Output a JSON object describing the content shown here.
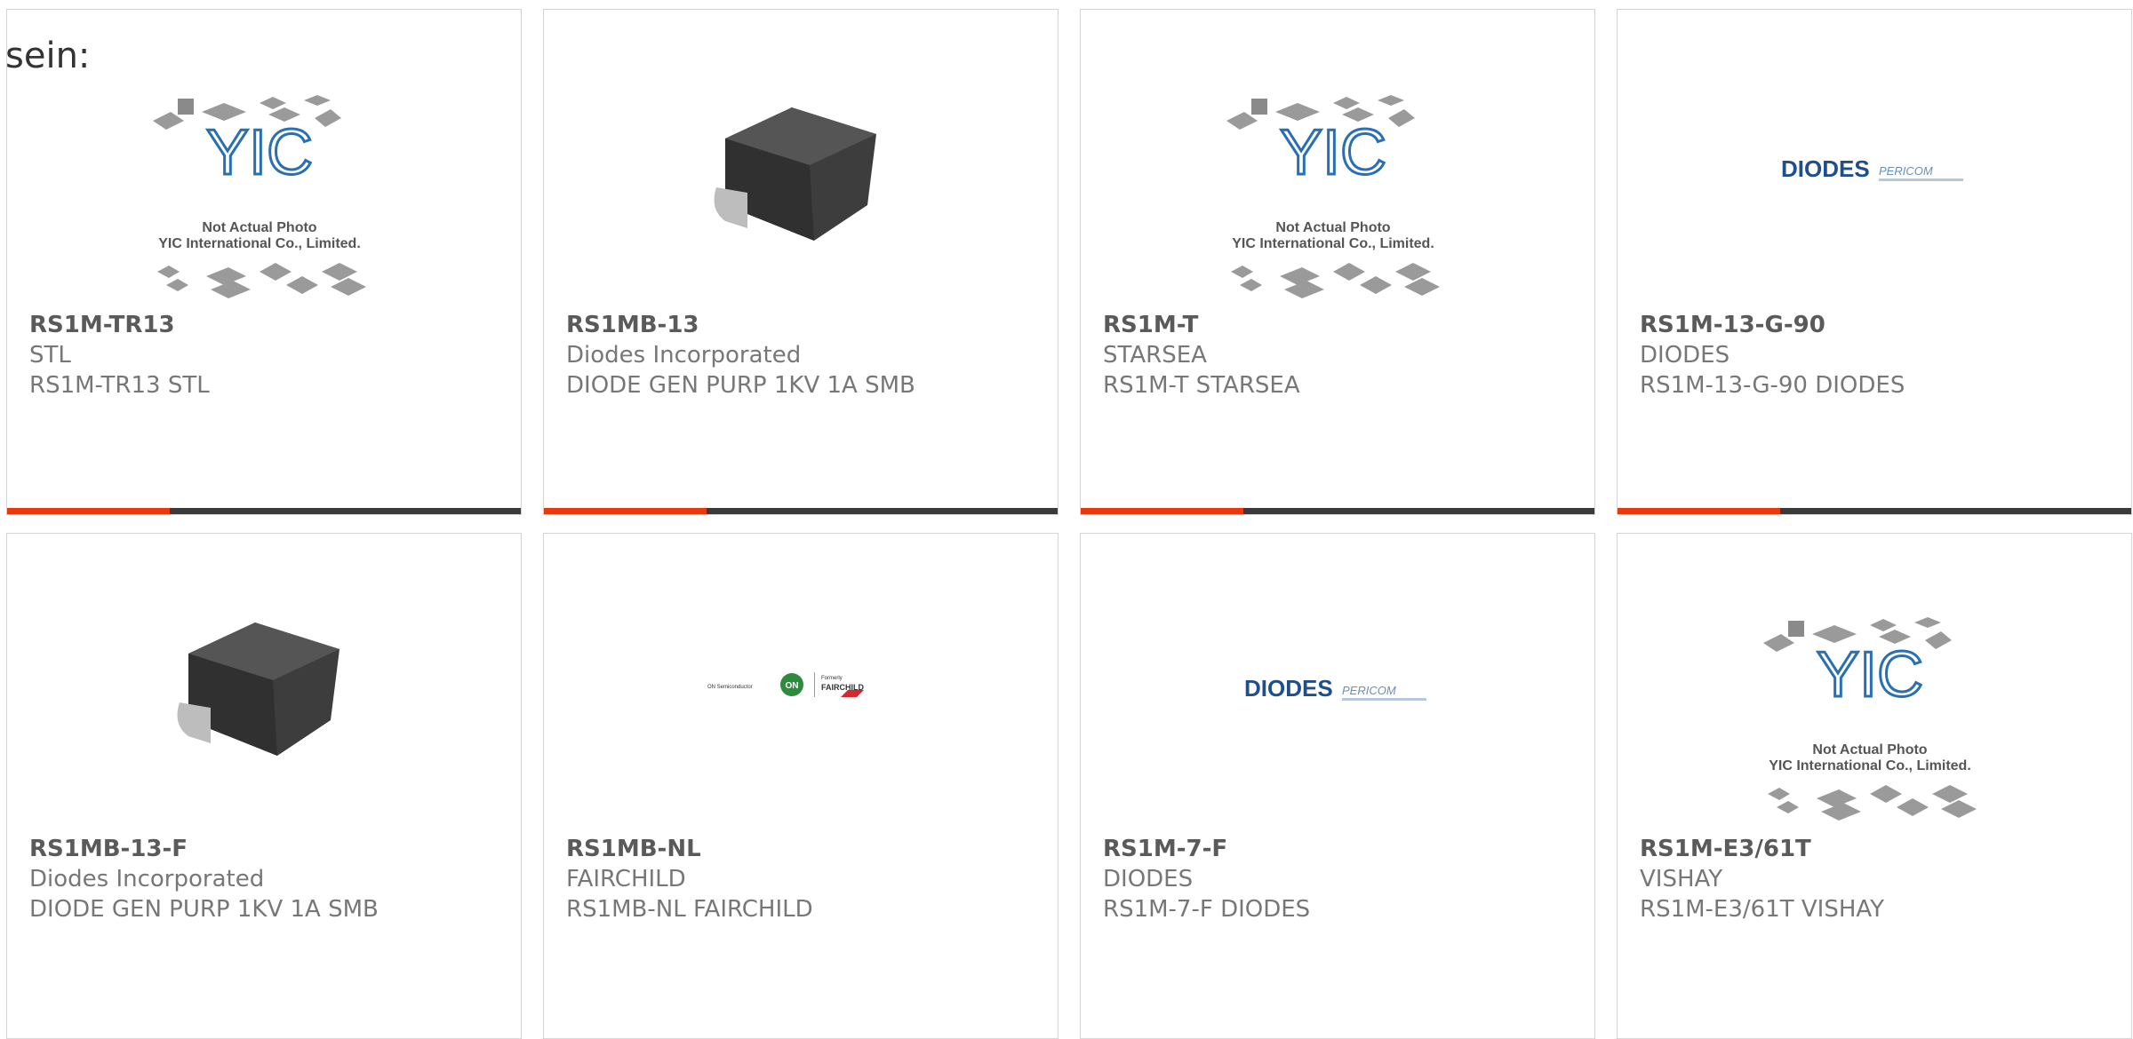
{
  "lead_text": "sein:",
  "placeholder_labels": {
    "line1": "Not Actual Photo",
    "line2": "YIC International Co., Limited.",
    "logo": "YIC"
  },
  "brand_labels": {
    "diodes": "DIODES",
    "pericom": "PERICOM",
    "on_semi": "ON Semiconductor",
    "on": "ON",
    "formerly": "Formerly",
    "fairchild": "FAIRCHILD"
  },
  "products": [
    {
      "name": "RS1M-TR13",
      "manufacturer": "STL",
      "description": "RS1M-TR13 STL",
      "image": "placeholder"
    },
    {
      "name": "RS1MB-13",
      "manufacturer": "Diodes Incorporated",
      "description": "DIODE GEN PURP 1KV 1A SMB",
      "image": "smb-package"
    },
    {
      "name": "RS1M-T",
      "manufacturer": "STARSEA",
      "description": "RS1M-T STARSEA",
      "image": "placeholder"
    },
    {
      "name": "RS1M-13-G-90",
      "manufacturer": "DIODES",
      "description": "RS1M-13-G-90 DIODES",
      "image": "diodes-logo"
    },
    {
      "name": "RS1MB-13-F",
      "manufacturer": "Diodes Incorporated",
      "description": "DIODE GEN PURP 1KV 1A SMB",
      "image": "smb-package"
    },
    {
      "name": "RS1MB-NL",
      "manufacturer": "FAIRCHILD",
      "description": "RS1MB-NL FAIRCHILD",
      "image": "onsemi-fairchild-logo"
    },
    {
      "name": "RS1M-7-F",
      "manufacturer": "DIODES",
      "description": "RS1M-7-F DIODES",
      "image": "diodes-logo"
    },
    {
      "name": "RS1M-E3/61T",
      "manufacturer": "VISHAY",
      "description": "RS1M-E3/61T VISHAY",
      "image": "placeholder"
    }
  ],
  "colors": {
    "accent": "#e8380d",
    "bar": "#3a3a3a",
    "border": "#d4d4d4"
  }
}
